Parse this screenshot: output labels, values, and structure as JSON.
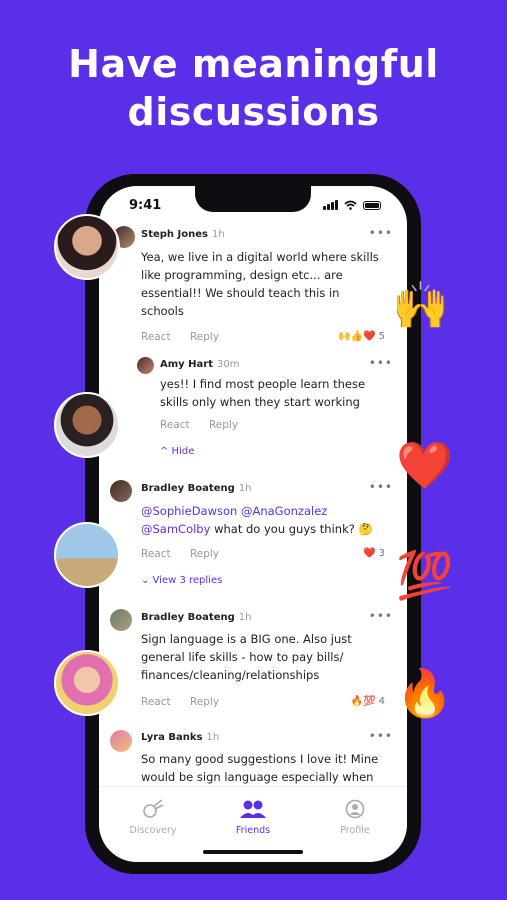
{
  "headline": {
    "line1": "Have meaningful",
    "line2": "discussions"
  },
  "status_bar": {
    "time": "9:41"
  },
  "comments": [
    {
      "name": "Steph Jones",
      "time": "1h",
      "text_lines": [
        "Yea, we live in a digital world where skills",
        "like programming, design etc... are",
        "essential!! We should teach this in",
        "schools"
      ],
      "react_label": "React",
      "reply_label": "Reply",
      "reactions": "🙌👍❤️",
      "reaction_count": "5"
    },
    {
      "name": "Amy Hart",
      "time": "30m",
      "text_lines": [
        "yes!! I find most people learn these",
        "skills only when they start working"
      ],
      "react_label": "React",
      "reply_label": "Reply",
      "toggle": "^ Hide"
    },
    {
      "name": "Bradley Boateng",
      "time": "1h",
      "mention1": "@SophieDawson",
      "mention2": "@AnaGonzalez",
      "mention3": "@SamColby",
      "text_rest": " what do you guys think? 🤔",
      "react_label": "React",
      "reply_label": "Reply",
      "reactions": "❤️",
      "reaction_count": "3",
      "toggle": "⌄ View 3 replies"
    },
    {
      "name": "Bradley Boateng",
      "time": "1h",
      "text_lines": [
        "Sign language is a BIG one. Also just",
        "general life skills - how to pay bills/",
        "finances/cleaning/relationships"
      ],
      "react_label": "React",
      "reply_label": "Reply",
      "reactions": "🔥💯",
      "reaction_count": "4"
    },
    {
      "name": "Lyra Banks",
      "time": "1h",
      "text_lines": [
        "So many good suggestions I love it! Mine",
        "would be sign language especially when"
      ]
    }
  ],
  "more_icon": "•••",
  "tabs": [
    {
      "label": "Discovery",
      "icon": "comet-icon",
      "active": false
    },
    {
      "label": "Friends",
      "icon": "friends-icon",
      "active": true
    },
    {
      "label": "Profile",
      "icon": "profile-icon",
      "active": false
    }
  ],
  "floating_emojis": [
    "🙌",
    "❤️",
    "💯",
    "🔥"
  ],
  "colors": {
    "brand": "#5b2ee8",
    "background": "#5b2ee8"
  }
}
